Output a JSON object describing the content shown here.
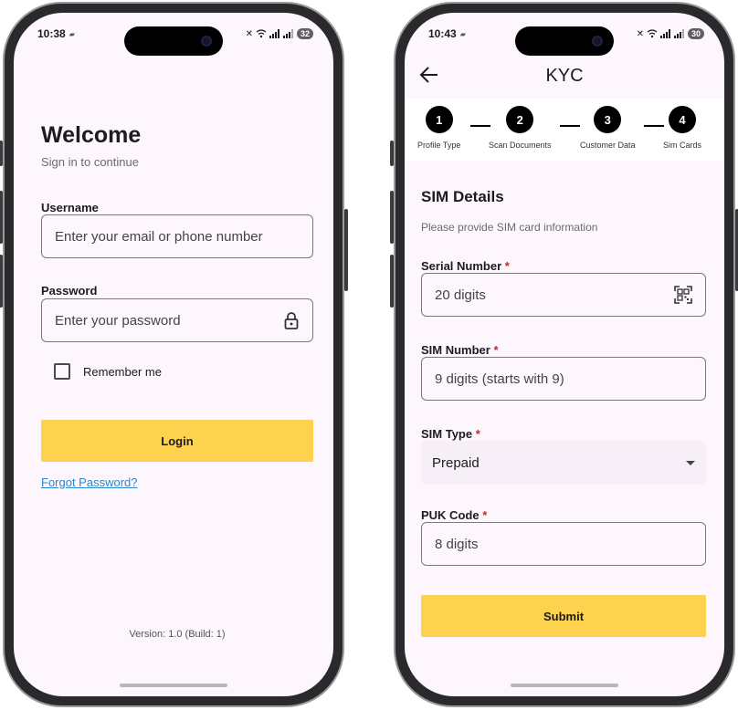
{
  "left_screen": {
    "status": {
      "time": "10:38",
      "battery": "32"
    },
    "title": "Welcome",
    "subtitle": "Sign in to continue",
    "username": {
      "label": "Username",
      "placeholder": "Enter your email or phone number"
    },
    "password": {
      "label": "Password",
      "placeholder": "Enter your password",
      "icon": "lock-icon"
    },
    "remember_label": "Remember me",
    "login_label": "Login",
    "forgot_label": "Forgot Password?",
    "version": "Version: 1.0 (Build: 1)"
  },
  "right_screen": {
    "status": {
      "time": "10:43",
      "battery": "30"
    },
    "app_title": "KYC",
    "steps": [
      {
        "number": "1",
        "label": "Profile Type"
      },
      {
        "number": "2",
        "label": "Scan Documents"
      },
      {
        "number": "3",
        "label": "Customer Data"
      },
      {
        "number": "4",
        "label": "Sim Cards"
      }
    ],
    "heading": "SIM Details",
    "hint": "Please provide SIM card information",
    "required_mark": "*",
    "serial": {
      "label": "Serial Number",
      "placeholder": "20 digits",
      "icon": "qr-scan-icon"
    },
    "sim_number": {
      "label": "SIM Number",
      "placeholder": "9 digits (starts with 9)"
    },
    "sim_type": {
      "label": "SIM Type",
      "value": "Prepaid"
    },
    "puk": {
      "label": "PUK Code",
      "placeholder": "8 digits"
    },
    "submit_label": "Submit"
  },
  "colors": {
    "background": "#fdf6fd",
    "primary_button": "#fdd24e",
    "link": "#2f86c9",
    "required": "#c62828",
    "step_circle": "#000000"
  }
}
